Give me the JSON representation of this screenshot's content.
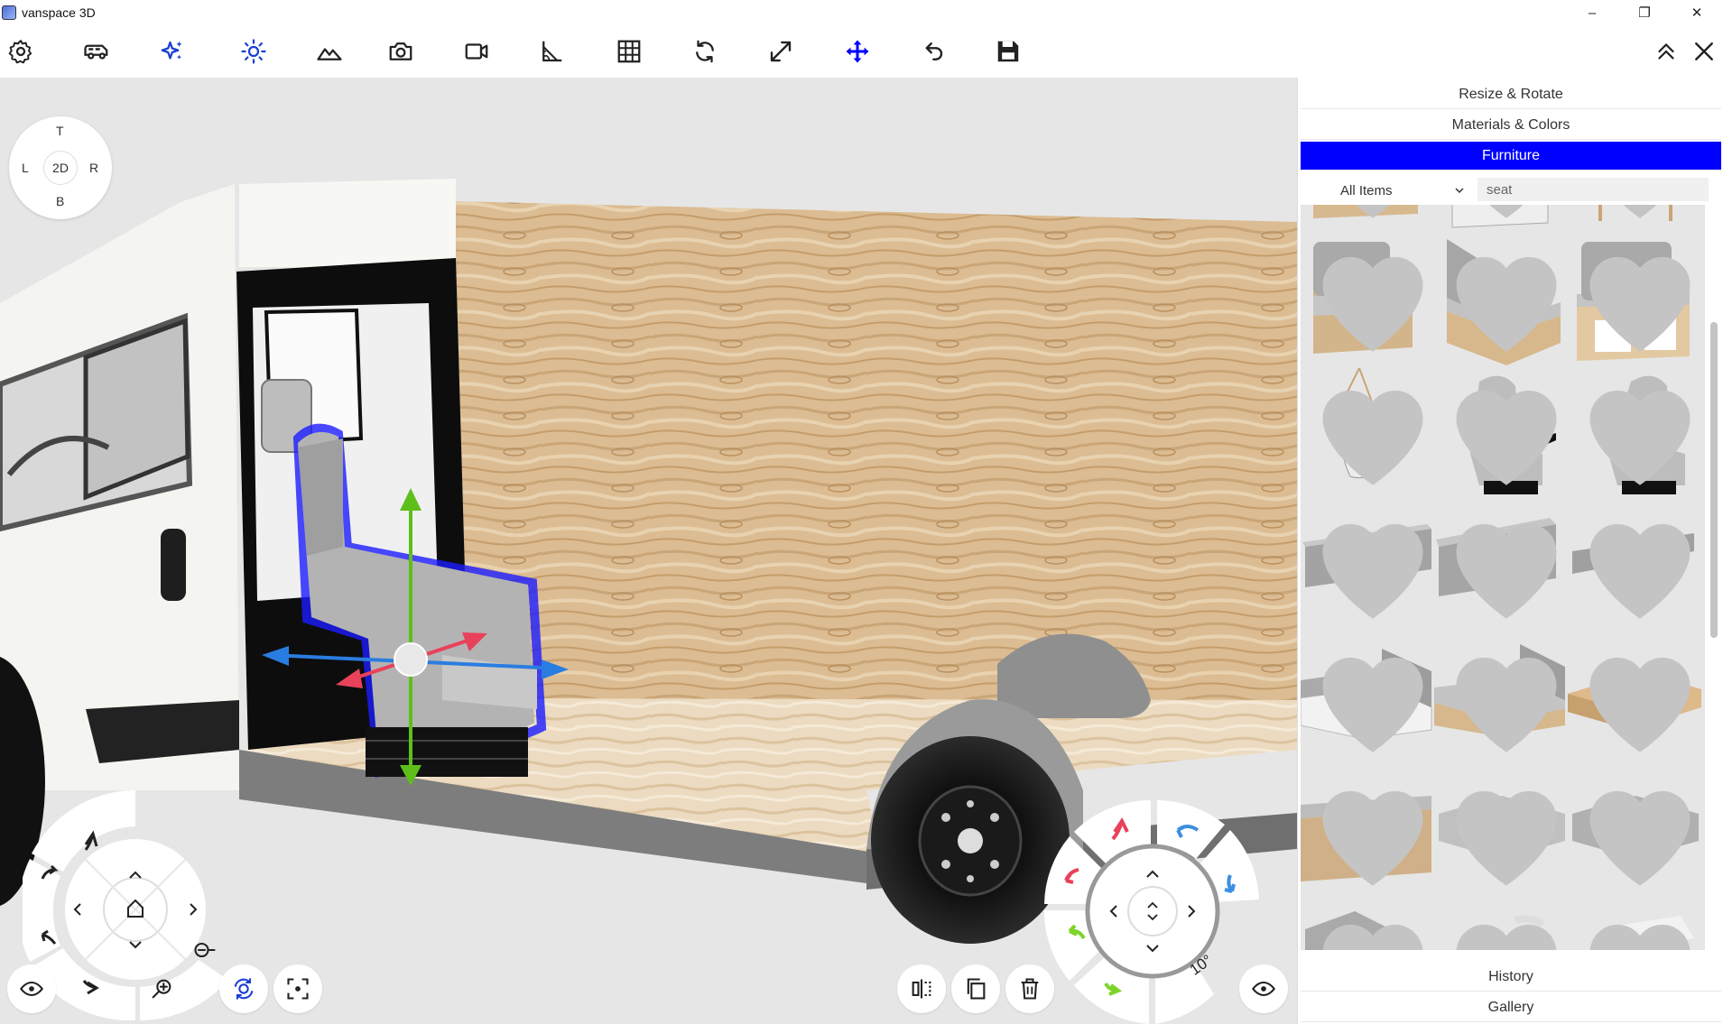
{
  "window": {
    "title": "vanspace 3D",
    "controls": {
      "minimize": "–",
      "maximize": "❐",
      "close": "✕"
    }
  },
  "toolbar": {
    "tools": [
      {
        "name": "settings-icon"
      },
      {
        "name": "van-icon"
      },
      {
        "name": "sparkle-icon"
      },
      {
        "name": "sun-icon"
      },
      {
        "name": "landscape-icon"
      },
      {
        "name": "camera-icon"
      },
      {
        "name": "video-icon"
      },
      {
        "name": "measure-angle-icon"
      },
      {
        "name": "grid-icon"
      },
      {
        "name": "sync-icon"
      },
      {
        "name": "expand-icon"
      },
      {
        "name": "move-icon"
      },
      {
        "name": "undo-icon"
      },
      {
        "name": "save-icon"
      }
    ],
    "right": [
      {
        "name": "collapse-up-icon"
      },
      {
        "name": "close-icon"
      }
    ]
  },
  "view_cube": {
    "top": "T",
    "left": "L",
    "center": "2D",
    "right": "R",
    "bottom": "B"
  },
  "rotate_step": "10°",
  "panel": {
    "tabs": {
      "resize": "Resize & Rotate",
      "materials": "Materials & Colors",
      "furniture": "Furniture",
      "history": "History",
      "gallery": "Gallery"
    },
    "filter": {
      "category": "All Items",
      "search_value": "seat",
      "search_placeholder": ""
    }
  },
  "colors": {
    "accent": "#0000ff",
    "wood": "#d8b990",
    "gray": "#9a9a9a",
    "red_arrow": "#e8415a",
    "blue_arrow": "#3b8fe0",
    "green_arrow": "#7ed32a"
  }
}
